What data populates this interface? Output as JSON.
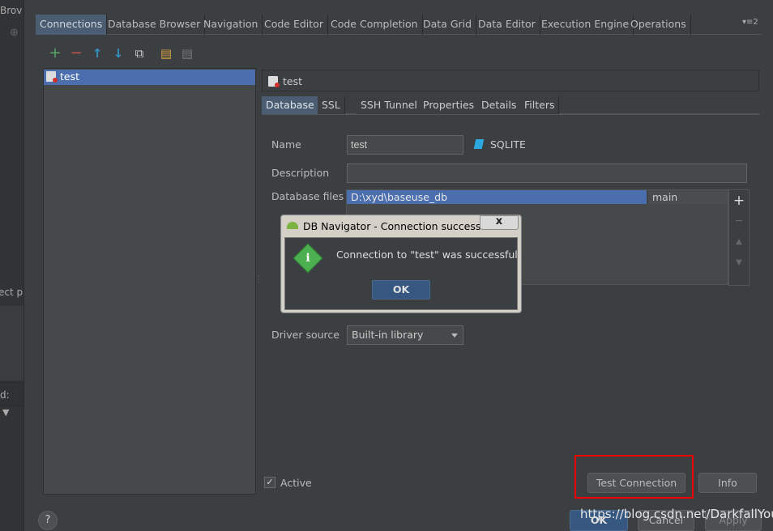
{
  "background_ide": {
    "fragment_top": "Brov",
    "fragment_mid": "ect p",
    "fragment_low": "d:"
  },
  "top_tabs": [
    {
      "label": "Connections",
      "active": true
    },
    {
      "label": "Database Browser",
      "active": false
    },
    {
      "label": "Navigation",
      "active": false
    },
    {
      "label": "Code Editor",
      "active": false
    },
    {
      "label": "Code Completion",
      "active": false
    },
    {
      "label": "Data Grid",
      "active": false
    },
    {
      "label": "Data Editor",
      "active": false
    },
    {
      "label": "Execution Engine",
      "active": false
    },
    {
      "label": "Operations",
      "active": false
    }
  ],
  "tab_overflow": "▾≡2",
  "toolbar": {
    "add": "+",
    "remove": "−",
    "move_up": "↑",
    "move_down": "↓",
    "copy": "⧉",
    "paste": "▤",
    "paste2": "▤"
  },
  "connections": [
    {
      "label": "test",
      "selected": true
    }
  ],
  "detail_header": {
    "label": "test"
  },
  "detail_tabs": [
    {
      "label": "Database",
      "active": true
    },
    {
      "label": "SSL",
      "active": false
    },
    {
      "label": "SSH Tunnel",
      "active": false
    },
    {
      "label": "Properties",
      "active": false
    },
    {
      "label": "Details",
      "active": false
    },
    {
      "label": "Filters",
      "active": false
    }
  ],
  "form": {
    "name_label": "Name",
    "name_value": "test",
    "db_type": "SQLITE",
    "description_label": "Description",
    "description_value": "",
    "dbfiles_label": "Database files",
    "dbfile_path": "D:\\xyd\\baseuse_db",
    "dbfile_schema": "main",
    "driver_label": "Driver source",
    "driver_value": "Built-in library",
    "active_label": "Active",
    "active_checked": true
  },
  "side_buttons": {
    "add": "+",
    "remove": "−",
    "up": "▲",
    "down": "▼"
  },
  "buttons": {
    "test_connection": "Test Connection",
    "info": "Info",
    "help": "?",
    "ok": "OK",
    "cancel": "Cancel",
    "apply": "Apply"
  },
  "popup": {
    "title": "DB Navigator - Connection successf...",
    "close": "x",
    "message": "Connection to \"test\" was successful.",
    "ok": "OK",
    "icon": "info-icon"
  },
  "watermark": "https://blog.csdn.net/DarkfallYou",
  "colors": {
    "accent_selection": "#4b6eaf",
    "active_tab": "#4b5d72",
    "highlight_box": "#e00000",
    "add_icon": "#59a869",
    "remove_icon": "#c75450",
    "arrow_icon": "#3592c4"
  }
}
